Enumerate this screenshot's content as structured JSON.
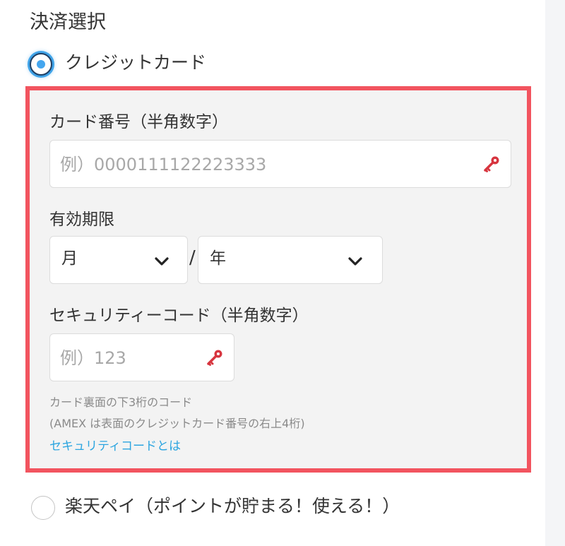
{
  "section_title": "決済選択",
  "payment_options": {
    "credit_card": {
      "label": "クレジットカード",
      "selected": true
    },
    "rakuten_pay": {
      "label": "楽天ペイ（ポイントが貯まる！使える！）",
      "selected": false
    }
  },
  "card_form": {
    "card_number": {
      "label": "カード番号（半角数字）",
      "placeholder": "例）0000111122223333",
      "icon": "key-icon"
    },
    "expiry": {
      "label": "有効期限",
      "month_value": "月",
      "separator": "/",
      "year_value": "年",
      "icon": "chevron-down-icon"
    },
    "security_code": {
      "label": "セキュリティーコード（半角数字）",
      "placeholder": "例）123",
      "icon": "key-icon",
      "note_line1": "カード裏面の下3桁のコード",
      "note_line2": "(AMEX は表面のクレジットカード番号の右上4桁)",
      "link_text": "セキュリティコードとは"
    }
  },
  "colors": {
    "highlight_border": "#f2545f",
    "form_background": "#f3f3f3",
    "link": "#2ca5e0",
    "radio_selected": "#44a6ef",
    "key_icon": "#d7353f"
  }
}
